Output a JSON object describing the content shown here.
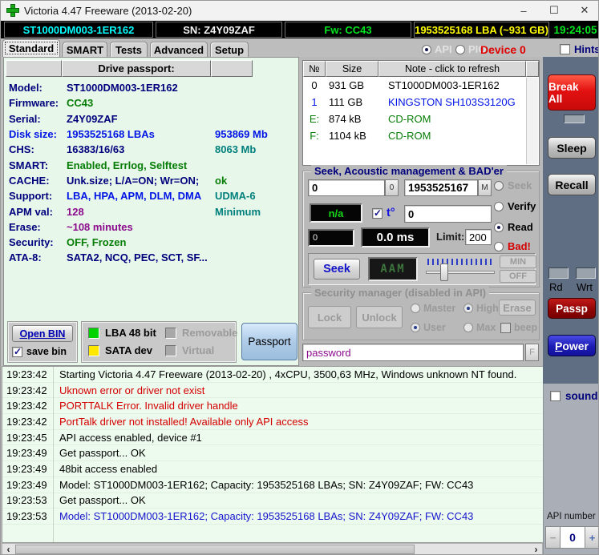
{
  "window": {
    "title": "Victoria 4.47  Freeware (2013-02-20)"
  },
  "icons": {
    "minimize": "–",
    "maximize": "☐",
    "close": "✕",
    "scroll_left": "‹",
    "scroll_right": "›"
  },
  "palette": {
    "sidebar": "#5f6e82",
    "mint_panel": "#e7f7e9",
    "break_all_red": "#e31111",
    "passp_maroon": "#8c0404",
    "power_blue": "#1c1cb4",
    "status_cyan": "#00ffff",
    "status_green": "#00e51e",
    "status_yellow": "#ffff00",
    "error_red": "#d40000",
    "info_blue": "#1414cd"
  },
  "statusbar": {
    "model": "ST1000DM003-1ER162",
    "serial": "SN: Z4Y09ZAF",
    "firmware": "Fw: CC43",
    "capacity": "1953525168 LBA (~931 GB)",
    "clock": "19:24:05"
  },
  "tabs": {
    "standard": "Standard",
    "smart": "SMART",
    "tests": "Tests",
    "advanced": "Advanced",
    "setup": "Setup"
  },
  "mode": {
    "api": "API",
    "pio": "PIO",
    "device": "Device 0",
    "hints": "Hints"
  },
  "passport": {
    "header": "Drive passport:",
    "rows": [
      {
        "label": "Model:",
        "value": "ST1000DM003-1ER162",
        "extra": ""
      },
      {
        "label": "Firmware:",
        "value": "CC43",
        "extra": ""
      },
      {
        "label": "Serial:",
        "value": "Z4Y09ZAF",
        "extra": ""
      },
      {
        "label": "Disk size:",
        "value": "1953525168 LBAs",
        "extra": "953869 Mb"
      },
      {
        "label": "CHS:",
        "value": "16383/16/63",
        "extra": "8063 Mb"
      },
      {
        "label": "SMART:",
        "value": "Enabled, Errlog, Selftest",
        "extra": ""
      },
      {
        "label": "CACHE:",
        "value": "Unk.size; L/A=ON; Wr=ON;",
        "extra": "ok"
      },
      {
        "label": "Support:",
        "value": "LBA, HPA, APM, DLM, DMA",
        "extra": "UDMA-6"
      },
      {
        "label": "APM val:",
        "value": "128",
        "extra": "Minimum"
      },
      {
        "label": "Erase:",
        "value": "~108 minutes",
        "extra": ""
      },
      {
        "label": "Security:",
        "value": "OFF, Frozen",
        "extra": ""
      },
      {
        "label": "ATA-8:",
        "value": "SATA2, NCQ, PEC, SCT, SF...",
        "extra": ""
      }
    ]
  },
  "bin_controls": {
    "open_bin": "Open BIN",
    "save_bin": "save bin",
    "lba48": "LBA 48 bit",
    "sata": "SATA dev",
    "removable": "Removable",
    "virtual": "Virtual",
    "passport_button": "Passport",
    "lba48_color": "#00d400",
    "sata_color": "#ffe800",
    "off_color": "#a8a8a8"
  },
  "drive_table": {
    "headers": {
      "num": "№",
      "size": "Size",
      "note": "Note - click to refresh"
    },
    "rows": [
      {
        "num": "0",
        "size": "931 GB",
        "note": "ST1000DM003-1ER162"
      },
      {
        "num": "1",
        "size": "111 GB",
        "note": "KINGSTON SH103S3120G"
      },
      {
        "num": "E:",
        "size": "874 kB",
        "note": "CD-ROM"
      },
      {
        "num": "F:",
        "size": "1104 kB",
        "note": "CD-ROM"
      }
    ]
  },
  "seek_panel": {
    "title": "Seek, Acoustic management & BAD'er",
    "start_lba": "0",
    "start_btn": "0",
    "end_lba": "1953525167",
    "end_btn": "M",
    "radio_seek": "Seek",
    "radio_verify": "Verify",
    "radio_read": "Read",
    "radio_bad": "Bad!",
    "lcd_na": "n/a",
    "temp_label": "t°",
    "temp_value": "0",
    "count_lcd": "0",
    "ms_lcd": "0.0 ms",
    "limit_label": "Limit:",
    "limit_value": "200",
    "seek_button": "Seek",
    "aam_lcd": "AAM",
    "min_button": "MIN",
    "off_button": "OFF"
  },
  "security": {
    "title": "Security manager (disabled in API)",
    "lock": "Lock",
    "unlock": "Unlock",
    "master": "Master",
    "high": "High",
    "user": "User",
    "max": "Max",
    "erase": "Erase",
    "beep": "beep",
    "password_value": "password",
    "f_button": "F"
  },
  "sidebar": {
    "break_all": "Break All",
    "sleep": "Sleep",
    "recall": "Recall",
    "rd": "Rd",
    "wrt": "Wrt",
    "passp": "Passp",
    "power": "Power",
    "sound": "sound",
    "api_number_label": "API number",
    "api_number_value": "0",
    "minus": "−",
    "plus": "+"
  },
  "log": {
    "entries": [
      {
        "time": "19:23:42",
        "text": "Starting Victoria 4.47  Freeware (2013-02-20) , 4xCPU, 3500,63 MHz, Windows unknown NT found."
      },
      {
        "time": "19:23:42",
        "text": "Uknown error or driver not exist"
      },
      {
        "time": "19:23:42",
        "text": "PORTTALK Error. Invalid driver handle"
      },
      {
        "time": "19:23:42",
        "text": "PortTalk driver not installed! Available only API access"
      },
      {
        "time": "19:23:45",
        "text": "API access enabled, device #1"
      },
      {
        "time": "19:23:49",
        "text": "Get passport... OK"
      },
      {
        "time": "19:23:49",
        "text": "48bit access enabled"
      },
      {
        "time": "19:23:49",
        "text": "Model: ST1000DM003-1ER162; Capacity: 1953525168 LBAs; SN: Z4Y09ZAF; FW: CC43"
      },
      {
        "time": "19:23:53",
        "text": "Get passport... OK"
      },
      {
        "time": "19:23:53",
        "text": "Model: ST1000DM003-1ER162; Capacity: 1953525168 LBAs; SN: Z4Y09ZAF; FW: CC43"
      }
    ]
  }
}
